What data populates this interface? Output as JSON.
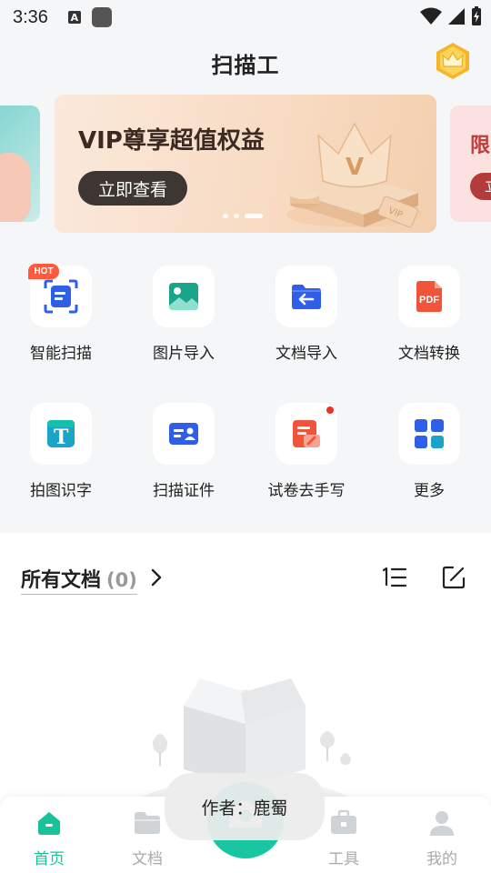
{
  "status": {
    "time": "3:36",
    "a_label": "A"
  },
  "header": {
    "title": "扫描工"
  },
  "banner": {
    "title": "VIP尊享超值权益",
    "button": "立即查看",
    "right_peek_title": "限",
    "right_peek_button": "立"
  },
  "tools": [
    {
      "label": "智能扫描",
      "badge": "HOT",
      "icon": "smart-scan-icon"
    },
    {
      "label": "图片导入",
      "icon": "image-import-icon"
    },
    {
      "label": "文档导入",
      "icon": "doc-import-icon"
    },
    {
      "label": "文档转换",
      "icon": "pdf-convert-icon",
      "icon_text": "PDF"
    },
    {
      "label": "拍图识字",
      "icon": "ocr-icon",
      "icon_text": "T"
    },
    {
      "label": "扫描证件",
      "icon": "id-scan-icon"
    },
    {
      "label": "试卷去手写",
      "icon": "remove-handwriting-icon",
      "has_dot": true
    },
    {
      "label": "更多",
      "icon": "more-grid-icon"
    }
  ],
  "docs": {
    "title": "所有文档",
    "count": "(0)"
  },
  "nav": {
    "items": [
      {
        "label": "首页",
        "icon": "home-icon",
        "active": true
      },
      {
        "label": "文档",
        "icon": "folder-icon"
      },
      {
        "label": "工具",
        "icon": "toolbox-icon"
      },
      {
        "label": "我的",
        "icon": "profile-icon"
      }
    ]
  },
  "toast": {
    "text": "作者：鹿蜀"
  },
  "colors": {
    "accent": "#18c39a",
    "primary_blue": "#2f5ee8",
    "hot": "#ff5a3a"
  }
}
